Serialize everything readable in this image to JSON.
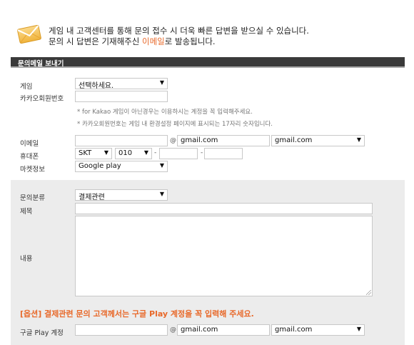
{
  "notice": {
    "line1": "게임 내 고객센터를 통해 문의 접수 시 더욱 빠른 답변을 받으실 수 있습니다.",
    "line2_prefix": "문의 시 답변은 기재해주신 ",
    "line2_highlight": "이메일",
    "line2_suffix": "로 발송됩니다."
  },
  "section_title": "문의메일 보내기",
  "form": {
    "game": {
      "label": "게임",
      "value": "선택하세요."
    },
    "kakao_id": {
      "label": "카카오회원번호",
      "value": ""
    },
    "hints": [
      "* for Kakao 게임이 아닌경우는 이용하시는 계정을 꼭 입력해주세요.",
      "* 카카오회원번호는 게임 내 환경설정 페이지에 표시되는 17자리 숫자입니다."
    ],
    "email": {
      "label": "이메일",
      "local": "",
      "at": "@",
      "domain": "gmail.com",
      "domain_select": "gmail.com"
    },
    "phone": {
      "label": "휴대폰",
      "carrier": "SKT",
      "prefix": "010",
      "dash": "-",
      "middle": "",
      "last": ""
    },
    "market": {
      "label": "마켓정보",
      "value": "Google play"
    },
    "category": {
      "label": "문의분류",
      "value": "결제관련"
    },
    "subject": {
      "label": "제목",
      "value": ""
    },
    "content": {
      "label": "내용",
      "value": ""
    },
    "warning": "[옵션] 결제관련 문의 고객께서는 구글 Play 계정을 꼭 입력해 주세요.",
    "google_play": {
      "label": "구글 Play 계정",
      "local": "",
      "at": "@",
      "domain": "gmail.com",
      "domain_select": "gmail.com"
    }
  },
  "colors": {
    "accent": "#e8692a",
    "bar": "#3a3a3a",
    "grey_area": "#ececec"
  },
  "icons": {
    "mail": "envelope-icon",
    "dropdown": "chevron-down-icon"
  }
}
